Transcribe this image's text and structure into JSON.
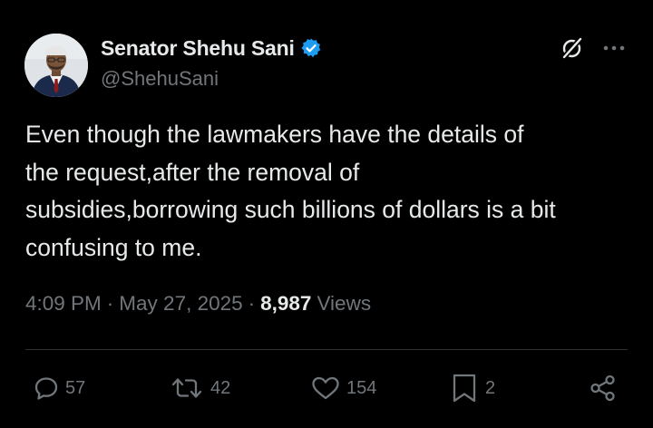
{
  "author": {
    "display_name": "Senator Shehu Sani",
    "handle": "@ShehuSani",
    "verified": true
  },
  "tweet": {
    "text": "Even though the lawmakers have the details of\nthe request,after the removal of\nsubsidies,borrowing such billions of dollars is a bit\nconfusing to me.",
    "time": "4:09 PM",
    "date": "May 27, 2025",
    "views_count": "8,987",
    "views_label": "Views"
  },
  "actions": {
    "replies": "57",
    "reposts": "42",
    "likes": "154",
    "bookmarks": "2"
  },
  "colors": {
    "background": "#000000",
    "text_primary": "#e7e9ea",
    "text_secondary": "#71767b",
    "verified_badge": "#1d9bf0",
    "divider": "#2f3336"
  },
  "icons": {
    "verified": "verified-badge-icon",
    "grok": "grok-icon",
    "more": "more-dots-icon",
    "reply": "reply-icon",
    "repost": "repost-icon",
    "like": "heart-icon",
    "bookmark": "bookmark-icon",
    "share": "share-icon"
  }
}
